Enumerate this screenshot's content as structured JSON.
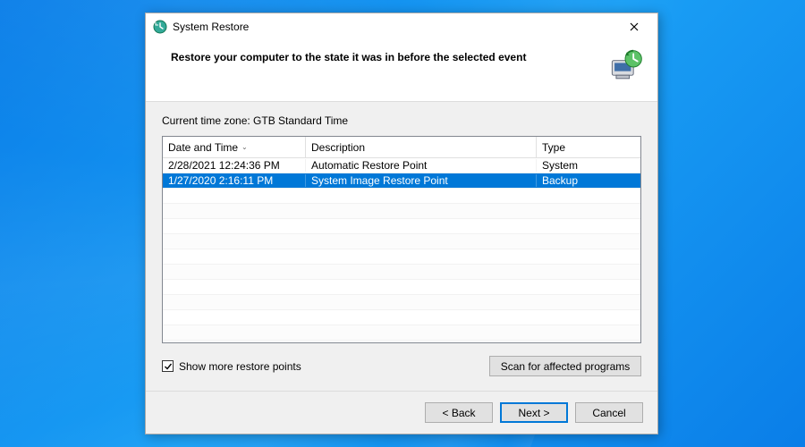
{
  "window": {
    "title": "System Restore"
  },
  "header": {
    "heading": "Restore your computer to the state it was in before the selected event"
  },
  "timezone": {
    "label": "Current time zone: GTB Standard Time"
  },
  "table": {
    "columns": {
      "datetime": "Date and Time",
      "description": "Description",
      "type": "Type"
    },
    "sort_column": "datetime",
    "rows": [
      {
        "datetime": "2/28/2021 12:24:36 PM",
        "description": "Automatic Restore Point",
        "type": "System",
        "selected": false
      },
      {
        "datetime": "1/27/2020 2:16:11 PM",
        "description": "System Image Restore Point",
        "type": "Backup",
        "selected": true
      }
    ]
  },
  "options": {
    "show_more_checked": true,
    "show_more_label": "Show more restore points",
    "scan_button": "Scan for affected programs"
  },
  "buttons": {
    "back": "< Back",
    "next": "Next >",
    "cancel": "Cancel"
  }
}
